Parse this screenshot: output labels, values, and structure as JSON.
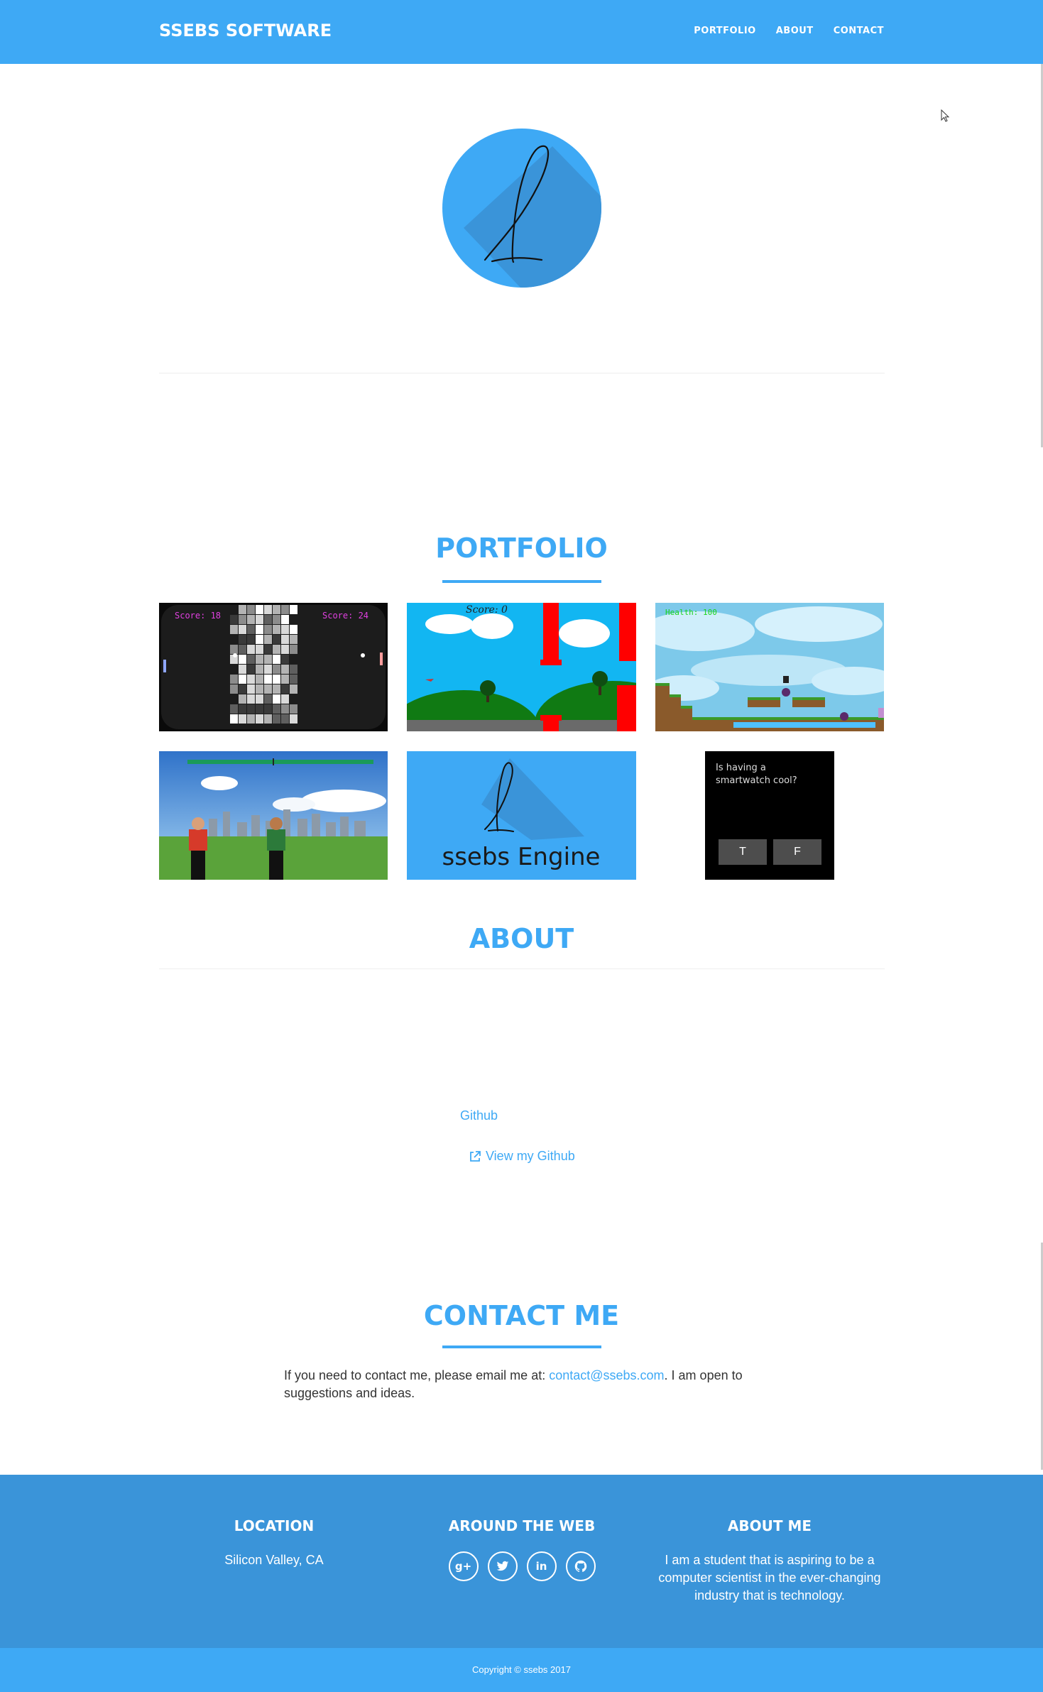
{
  "nav": {
    "brand": "SSEBS SOFTWARE",
    "links": [
      "PORTFOLIO",
      "ABOUT",
      "CONTACT"
    ]
  },
  "colors": {
    "accent": "#3ea9f5",
    "footer": "#3a94d9",
    "text": "#333333"
  },
  "portfolio": {
    "title": "PORTFOLIO",
    "tiles": [
      {
        "icon": "pong-game-thumbnail",
        "score_left": "Score: 18",
        "score_right": "Score: 24"
      },
      {
        "icon": "flappy-game-thumbnail",
        "score": "Score: 0"
      },
      {
        "icon": "platformer-game-thumbnail",
        "health": "Health: 100"
      },
      {
        "icon": "fighting-game-thumbnail"
      },
      {
        "icon": "ssebs-engine-thumbnail",
        "caption": "ssebs Engine"
      },
      {
        "icon": "smartwatch-quiz-thumbnail",
        "question": "Is having a smartwatch cool?",
        "btn_true": "T",
        "btn_false": "F"
      }
    ]
  },
  "about": {
    "title": "ABOUT",
    "github_label": "Github",
    "github_button": "View my Github"
  },
  "contact": {
    "title": "CONTACT ME",
    "text_before": "If you need to contact me, please email me at: ",
    "email": "contact@ssebs.com",
    "text_after": ". I am open to suggestions and ideas."
  },
  "footer": {
    "location_title": "LOCATION",
    "location": "Silicon Valley, CA",
    "web_title": "AROUND THE WEB",
    "socials": [
      "google-plus-icon",
      "twitter-icon",
      "linkedin-icon",
      "github-icon"
    ],
    "about_title": "ABOUT ME",
    "about_text": "I am a student that is aspiring to be a computer scientist in the ever-changing industry that is technology.",
    "copyright": "Copyright © ssebs 2017"
  }
}
